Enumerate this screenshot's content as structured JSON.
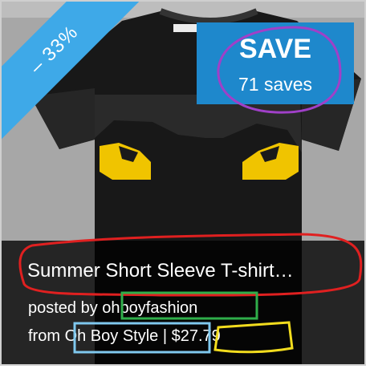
{
  "badge": {
    "discount": "– 33%"
  },
  "save_button": {
    "label": "SAVE",
    "count": "71 saves"
  },
  "product": {
    "title": "Summer Short Sleeve T-shirt…",
    "posted_prefix": "posted by",
    "author": "ohboyfashion",
    "from_prefix": "from",
    "store": "Oh Boy Style",
    "separator": "|",
    "price": "$27.79"
  },
  "colors": {
    "badge": "#3ea9e8",
    "save_button": "#1e88cc",
    "annotation_red": "#e02020",
    "annotation_purple": "#a040c8",
    "annotation_green": "#2fae4a",
    "annotation_blue": "#7fc8ee",
    "annotation_yellow": "#f2dc1e"
  }
}
